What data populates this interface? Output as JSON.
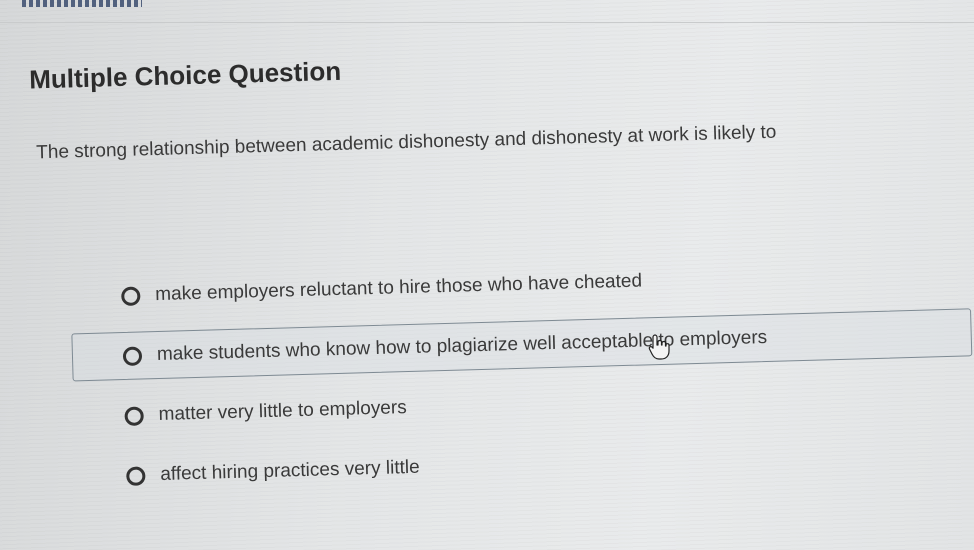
{
  "question": {
    "type_label": "Multiple Choice Question",
    "stem": "The strong relationship between academic dishonesty and dishonesty at work is likely to"
  },
  "choices": [
    {
      "label": "make employers reluctant to hire those who have cheated",
      "state": "unselected"
    },
    {
      "label": "make students who know how to plagiarize well acceptable to employers",
      "state": "hovered"
    },
    {
      "label": "matter very little to employers",
      "state": "unselected"
    },
    {
      "label": "affect hiring practices very little",
      "state": "unselected"
    }
  ],
  "cursor": {
    "icon": "hand-pointer-icon"
  },
  "colors": {
    "text": "#3a3a3a",
    "radio_border": "#333333",
    "hover_border": "#7e8a93"
  }
}
